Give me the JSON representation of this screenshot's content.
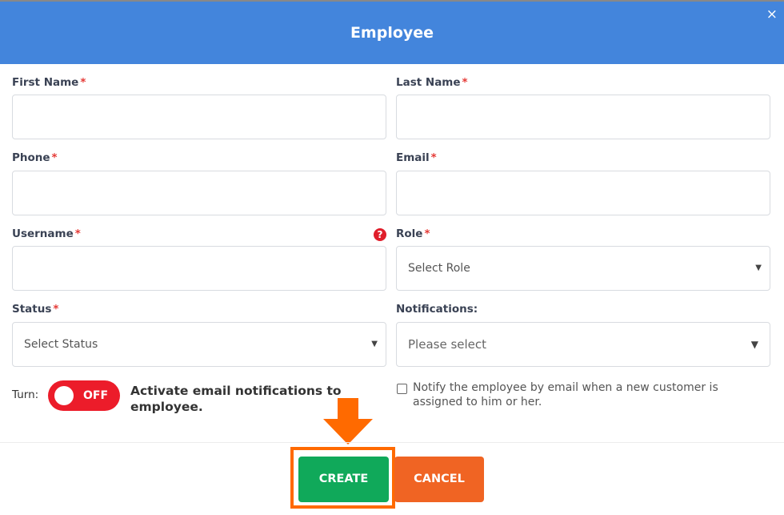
{
  "header": {
    "title": "Employee",
    "close_label": "×"
  },
  "fields": {
    "first_name": {
      "label": "First Name",
      "required": "*",
      "value": ""
    },
    "last_name": {
      "label": "Last Name",
      "required": "*",
      "value": ""
    },
    "phone": {
      "label": "Phone",
      "required": "*",
      "value": ""
    },
    "email": {
      "label": "Email",
      "required": "*",
      "value": ""
    },
    "username": {
      "label": "Username",
      "required": "*",
      "value": "",
      "help": "?"
    },
    "role": {
      "label": "Role",
      "required": "*",
      "value": "Select Role"
    },
    "status": {
      "label": "Status",
      "required": "*",
      "value": "Select Status"
    },
    "notifications": {
      "label": "Notifications:",
      "value": "Please select"
    }
  },
  "toggle": {
    "label": "Turn:",
    "state": "OFF",
    "description": "Activate email notifications to employee.",
    "color": "#ec1c2a"
  },
  "notify_checkbox": {
    "checked": false,
    "label": "Notify the employee by email when a new customer is assigned to him or her."
  },
  "footer": {
    "create_label": "CREATE",
    "cancel_label": "CANCEL"
  },
  "colors": {
    "header": "#4385dc",
    "create": "#10a95a",
    "cancel": "#f06423",
    "highlight": "#ff6a00"
  }
}
